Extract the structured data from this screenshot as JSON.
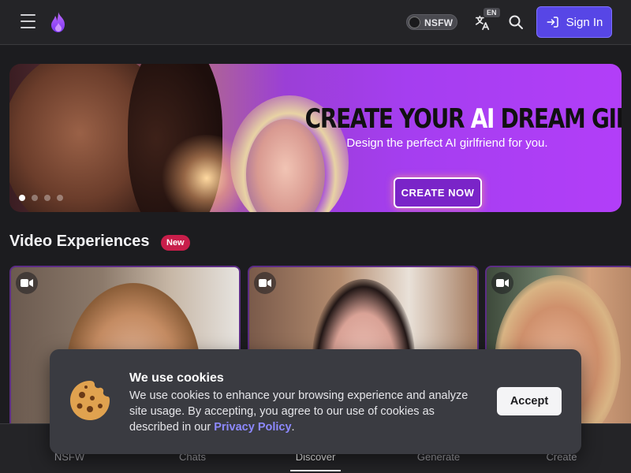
{
  "header": {
    "menu_icon": "hamburger-icon",
    "logo_icon": "flame-logo-icon",
    "nsfw_label": "NSFW",
    "lang_badge": "EN",
    "lang_icon": "translate-icon",
    "search_icon": "search-icon",
    "signin_label": "Sign In",
    "signin_icon": "sign-in-icon",
    "accent_color": "#5746e6"
  },
  "banner": {
    "title_prefix": "CREATE YOUR ",
    "title_highlight": "AI",
    "title_suffix": " DREAM GIRL",
    "subtitle": "Design the perfect AI girlfriend for you.",
    "cta_label": "CREATE NOW",
    "slides_count": 4,
    "active_slide": 1
  },
  "section": {
    "title": "Video Experiences",
    "badge": "New",
    "badge_color": "#c81e4a",
    "card_icon": "video-camera-icon",
    "cards": 3
  },
  "bottom_nav": {
    "items": [
      {
        "label": "NSFW",
        "active": false
      },
      {
        "label": "Chats",
        "active": false
      },
      {
        "label": "Discover",
        "active": true
      },
      {
        "label": "Generate",
        "active": false
      },
      {
        "label": "Create",
        "active": false
      }
    ]
  },
  "cookie": {
    "icon": "cookie-icon",
    "title": "We use cookies",
    "text": "We use cookies to enhance your browsing experience and analyze site usage. By accepting, you agree to our use of cookies as described in our ",
    "link": "Privacy Policy",
    "text_end": ".",
    "accept_label": "Accept"
  }
}
